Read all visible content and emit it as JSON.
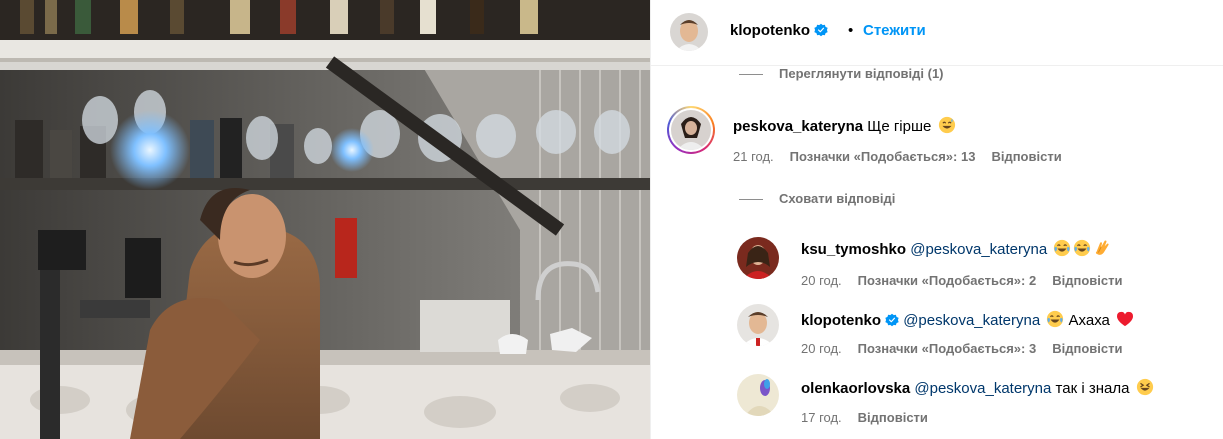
{
  "header": {
    "username": "klopotenko",
    "separator": "•",
    "follow_label": "Стежити"
  },
  "toggles": {
    "view_replies": "Переглянути відповіді (1)",
    "hide_replies": "Сховати відповіді"
  },
  "comments": [
    {
      "username": "peskova_kateryna",
      "text": "Ще гірше",
      "emoji": [
        "grinning-sweat-emoji"
      ],
      "time": "21 год.",
      "likes": "Позначки «Подобається»: 13",
      "reply_label": "Відповісти"
    },
    {
      "username": "ksu_tymoshko",
      "mention": "@peskova_kateryna",
      "text": "",
      "emoji": [
        "tears-of-joy-emoji",
        "tears-of-joy-emoji",
        "clapping-hands-emoji"
      ],
      "time": "20 год.",
      "likes": "Позначки «Подобається»: 2",
      "reply_label": "Відповісти"
    },
    {
      "username": "klopotenko",
      "mention": "@peskova_kateryna",
      "text": "Ахаха",
      "emoji": [
        "tears-of-joy-emoji",
        "red-heart-emoji"
      ],
      "time": "20 год.",
      "likes": "Позначки «Подобається»: 3",
      "reply_label": "Відповісти"
    },
    {
      "username": "olenkaorlovska",
      "mention": "@peskova_kateryna",
      "text": "так і знала",
      "emoji": [
        "laughing-emoji"
      ],
      "time": "17 год.",
      "reply_label": "Відповісти"
    }
  ],
  "colors": {
    "accent": "#0095f6",
    "mention": "#00376b",
    "secondary_text": "#737373",
    "verified": "#0095f6",
    "heart": "#ed1b2e"
  }
}
